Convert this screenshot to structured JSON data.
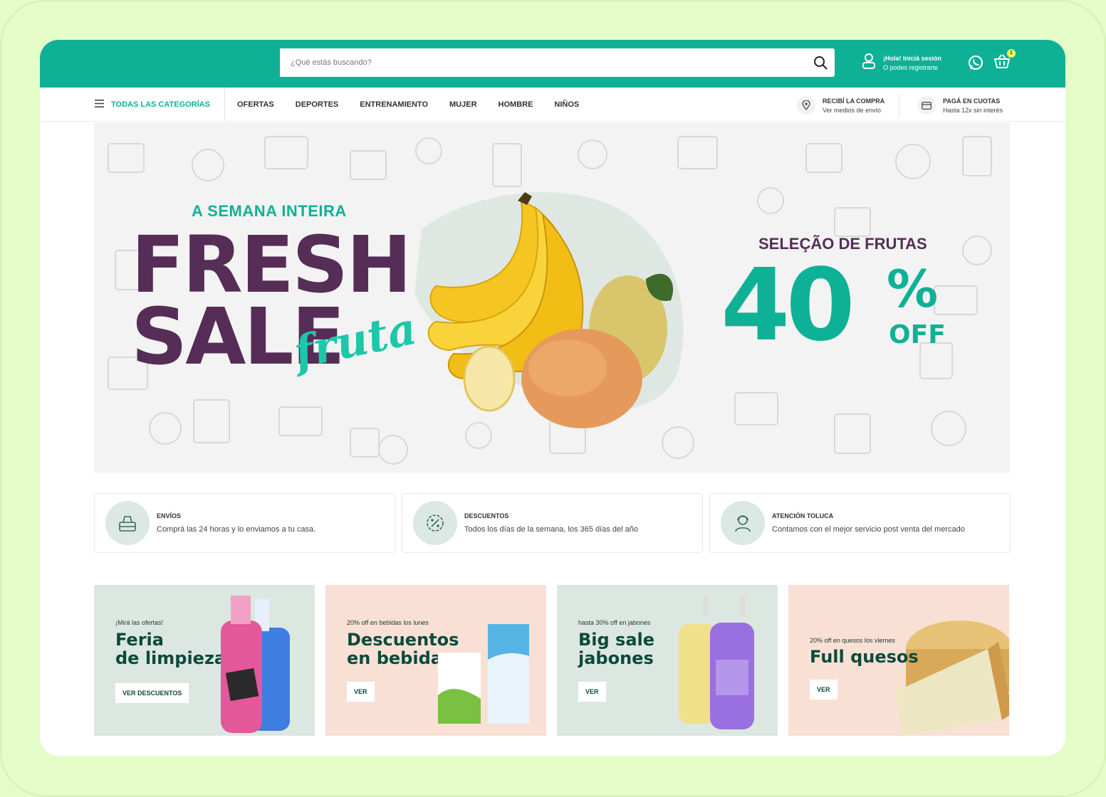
{
  "header": {
    "search_placeholder": "¿Qué estás buscando?",
    "account_title": "¡Hola! Iniciá sesión",
    "account_sub": "O podes registrarte",
    "cart_count": "1"
  },
  "nav": {
    "categories_label": "TODAS LAS CATEGORÍAS",
    "items": [
      "OFERTAS",
      "DEPORTES",
      "ENTRENAMIENTO",
      "MUJER",
      "HOMBRE",
      "NIÑOS"
    ],
    "shipping_title": "RECIBÍ LA COMPRA",
    "shipping_sub": "Ver medios de envío",
    "installments_title": "PAGÁ EN CUOTAS",
    "installments_sub": "Hasta 12x sin interés"
  },
  "hero": {
    "kicker": "A SEMANA INTEIRA",
    "line1": "FRESH",
    "line2": "SALE",
    "script": "fruta",
    "promo_title": "SELEÇÃO DE FRUTAS",
    "promo_value": "40",
    "promo_sign": "%",
    "promo_off": "OFF"
  },
  "features": [
    {
      "title": "ENVÍOS",
      "desc": "Comprá las 24 horas y lo enviamos a tu casa.",
      "icon": "delivery-icon"
    },
    {
      "title": "DESCUENTOS",
      "desc": "Todos los días de la semana, los 365 días del año",
      "icon": "percent-badge-icon"
    },
    {
      "title": "ATENCIÓN TOLUCA",
      "desc": "Contamos con el mejor servicio post venta del mercado",
      "icon": "support-agent-icon"
    }
  ],
  "promos": [
    {
      "kicker": "¡Mirá las ofertas!",
      "title1": "Feria",
      "title2": "de limpieza",
      "button": "VER DESCUENTOS",
      "bg": "#dde7e2"
    },
    {
      "kicker": "20% off en bebidas los lunes",
      "title1": "Descuentos",
      "title2": "en bebidas",
      "button": "VER",
      "bg": "#f8e0d5"
    },
    {
      "kicker": "hasta 30% off en jabones",
      "title1": "Big sale",
      "title2": "jabones",
      "button": "VER",
      "bg": "#dde7e2"
    },
    {
      "kicker": "20% off en quesos los viernes",
      "title1": "Full quesos",
      "title2": "",
      "button": "VER",
      "bg": "#f8e0d5"
    }
  ],
  "colors": {
    "brand": "#0fb196",
    "accent_purple": "#562d57",
    "dark_green": "#0b4a3b"
  }
}
